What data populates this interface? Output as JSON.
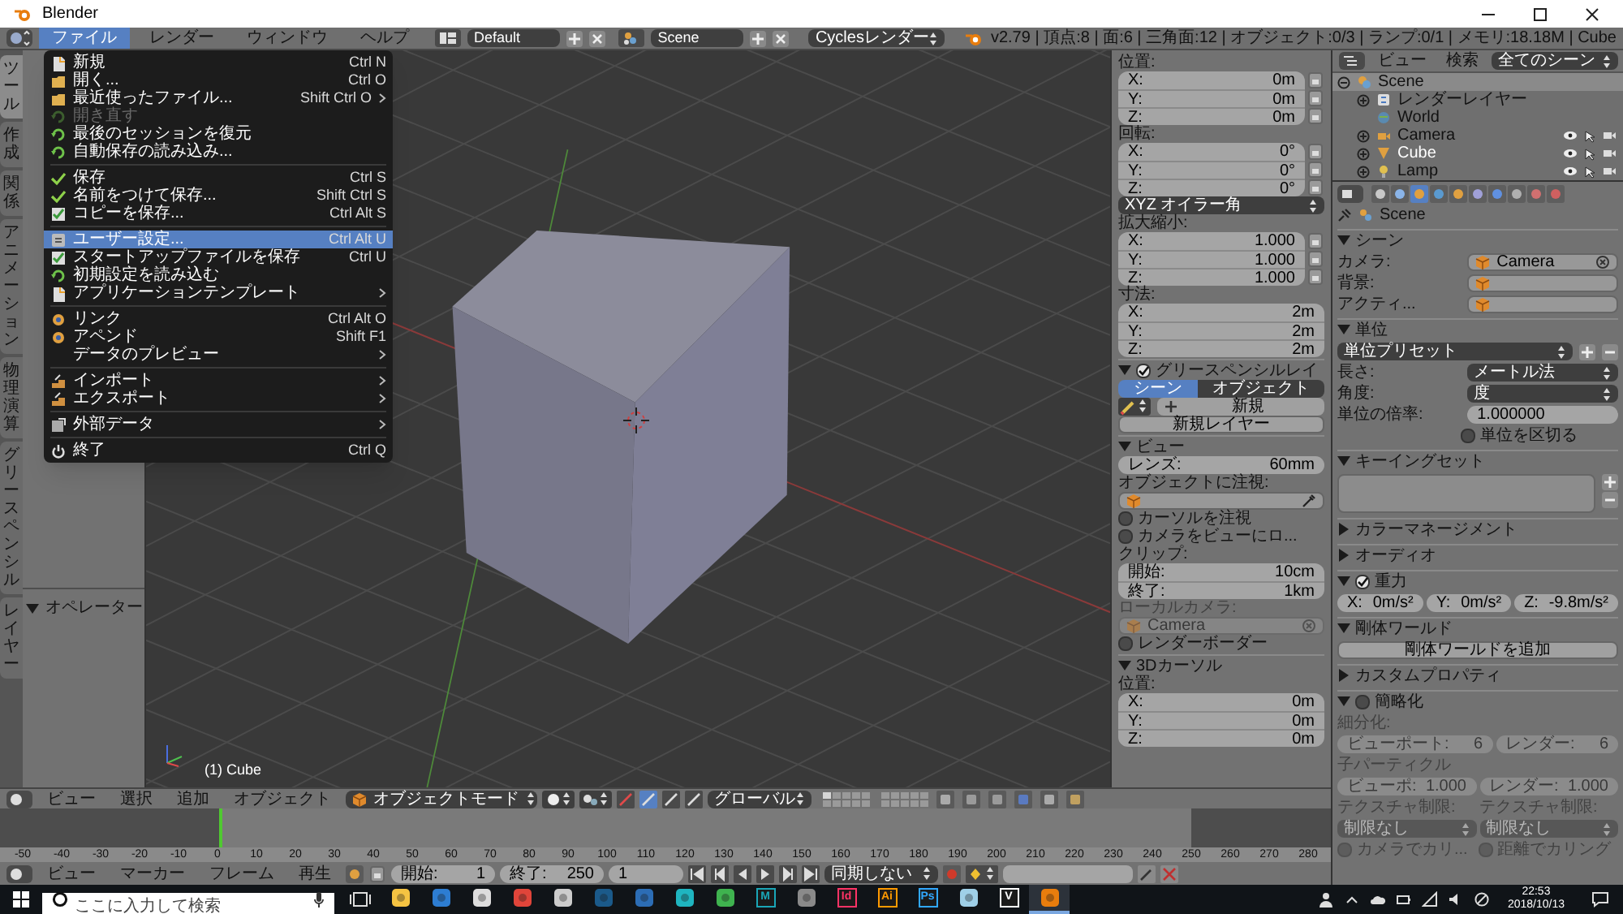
{
  "window": {
    "title": "Blender"
  },
  "info_header": {
    "menus": [
      {
        "label": "ファイル",
        "selected": true
      },
      {
        "label": "レンダー",
        "selected": false
      },
      {
        "label": "ウィンドウ",
        "selected": false
      },
      {
        "label": "ヘルプ",
        "selected": false
      }
    ],
    "layout": "Default",
    "scene": "Scene",
    "engine": "Cyclesレンダー",
    "stats": "v2.79 | 頂点:8 | 面:6 | 三角面:12 | オブジェクト:0/3 | ランプ:0/1 | メモリ:18.18M | Cube"
  },
  "file_menu": [
    {
      "kind": "file",
      "label": "新規",
      "shortcut": "Ctrl N",
      "submenu": false,
      "disabled": false,
      "selected": false
    },
    {
      "kind": "folder",
      "label": "開く...",
      "shortcut": "Ctrl O",
      "submenu": false,
      "disabled": false,
      "selected": false
    },
    {
      "kind": "folder",
      "label": "最近使ったファイル...",
      "shortcut": "Shift Ctrl O",
      "submenu": true,
      "disabled": false,
      "selected": false
    },
    {
      "kind": "recover",
      "label": "開き直す",
      "submenu": false,
      "disabled": true,
      "selected": false
    },
    {
      "kind": "recover",
      "label": "最後のセッションを復元",
      "submenu": false,
      "disabled": false,
      "selected": false
    },
    {
      "kind": "recover",
      "label": "自動保存の読み込み...",
      "submenu": false,
      "disabled": false,
      "selected": false
    },
    {
      "kind": "separator"
    },
    {
      "kind": "check",
      "label": "保存",
      "shortcut": "Ctrl S",
      "submenu": false,
      "disabled": false,
      "selected": false
    },
    {
      "kind": "check",
      "label": "名前をつけて保存...",
      "shortcut": "Shift Ctrl S",
      "submenu": false,
      "disabled": false,
      "selected": false
    },
    {
      "kind": "checkbox",
      "label": "コピーを保存...",
      "shortcut": "Ctrl Alt S",
      "submenu": false,
      "disabled": false,
      "selected": false
    },
    {
      "kind": "separator"
    },
    {
      "kind": "prefs",
      "label": "ユーザー設定...",
      "shortcut": "Ctrl Alt U",
      "submenu": false,
      "disabled": false,
      "selected": true
    },
    {
      "kind": "checkbox",
      "label": "スタートアップファイルを保存",
      "shortcut": "Ctrl U",
      "submenu": false,
      "disabled": false,
      "selected": false
    },
    {
      "kind": "recover",
      "label": "初期設定を読み込む",
      "submenu": false,
      "disabled": false,
      "selected": false
    },
    {
      "kind": "file",
      "label": "アプリケーションテンプレート",
      "submenu": true,
      "disabled": false,
      "selected": false
    },
    {
      "kind": "separator"
    },
    {
      "kind": "link",
      "label": "リンク",
      "shortcut": "Ctrl Alt O",
      "submenu": false,
      "disabled": false,
      "selected": false
    },
    {
      "kind": "link",
      "label": "アペンド",
      "shortcut": "Shift F1",
      "submenu": false,
      "disabled": false,
      "selected": false
    },
    {
      "kind": "none",
      "label": "データのプレビュー",
      "submenu": true,
      "disabled": false,
      "selected": false
    },
    {
      "kind": "separator"
    },
    {
      "kind": "io",
      "label": "インポート",
      "submenu": true,
      "disabled": false,
      "selected": false
    },
    {
      "kind": "io",
      "label": "エクスポート",
      "submenu": true,
      "disabled": false,
      "selected": false
    },
    {
      "kind": "separator"
    },
    {
      "kind": "external",
      "label": "外部データ",
      "submenu": true,
      "disabled": false,
      "selected": false
    },
    {
      "kind": "separator"
    },
    {
      "kind": "power",
      "label": "終了",
      "shortcut": "Ctrl Q",
      "submenu": false,
      "disabled": false,
      "selected": false
    }
  ],
  "toolshelf": {
    "tabs": [
      {
        "label": "ツール",
        "selected": true
      },
      {
        "label": "作成",
        "selected": false
      },
      {
        "label": "関係",
        "selected": false
      },
      {
        "label": "アニメーション",
        "selected": false
      },
      {
        "label": "物理演算",
        "selected": false
      },
      {
        "label": "グリースペンシル",
        "selected": false
      },
      {
        "label": "レイヤー",
        "selected": false
      }
    ],
    "operator": {
      "title": "オペレーター",
      "expanded": true
    }
  },
  "viewport": {
    "label": "(1) Cube"
  },
  "npanel": {
    "rows": [
      {
        "kind": "label",
        "text": "位置:"
      },
      {
        "kind": "vector",
        "locks": true,
        "fields": [
          {
            "label": "X:",
            "value": "0m"
          },
          {
            "label": "Y:",
            "value": "0m"
          },
          {
            "label": "Z:",
            "value": "0m"
          }
        ]
      },
      {
        "kind": "label",
        "text": "回転:"
      },
      {
        "kind": "vector",
        "locks": true,
        "fields": [
          {
            "label": "X:",
            "value": "0°"
          },
          {
            "label": "Y:",
            "value": "0°"
          },
          {
            "label": "Z:",
            "value": "0°"
          }
        ]
      },
      {
        "kind": "dropdown",
        "value": "XYZ オイラー角"
      },
      {
        "kind": "label",
        "text": "拡大縮小:"
      },
      {
        "kind": "vector",
        "locks": true,
        "fields": [
          {
            "label": "X:",
            "value": "1.000"
          },
          {
            "label": "Y:",
            "value": "1.000"
          },
          {
            "label": "Z:",
            "value": "1.000"
          }
        ]
      },
      {
        "kind": "label",
        "text": "寸法:"
      },
      {
        "kind": "vector",
        "locks": false,
        "fields": [
          {
            "label": "X:",
            "value": "2m"
          },
          {
            "label": "Y:",
            "value": "2m"
          },
          {
            "label": "Z:",
            "value": "2m"
          }
        ]
      },
      {
        "kind": "panel",
        "title": "グリースペンシルレイ",
        "expanded": true,
        "checked": true
      },
      {
        "kind": "tabs",
        "items": [
          {
            "label": "シーン",
            "selected": true
          },
          {
            "label": "オブジェクト",
            "selected": false
          }
        ]
      },
      {
        "kind": "new-row",
        "text": "新規"
      },
      {
        "kind": "button",
        "text": "新規レイヤー"
      },
      {
        "kind": "panel",
        "title": "ビュー",
        "expanded": true
      },
      {
        "kind": "number",
        "label": "レンズ:",
        "value": "60mm"
      },
      {
        "kind": "label",
        "text": "オブジェクトに注視:"
      },
      {
        "kind": "field",
        "eyedropper": true
      },
      {
        "kind": "checkbox",
        "label": "カーソルを注視",
        "checked": false
      },
      {
        "kind": "checkbox",
        "label": "カメラをビューにロ...",
        "checked": false
      },
      {
        "kind": "label",
        "text": "クリップ:"
      },
      {
        "kind": "vector",
        "locks": false,
        "fields": [
          {
            "label": "開始:",
            "value": "10cm"
          },
          {
            "label": "終了:",
            "value": "1km"
          }
        ]
      },
      {
        "kind": "label",
        "text": "ローカルカメラ:",
        "disabled": true
      },
      {
        "kind": "field",
        "value": "Camera",
        "clear": true,
        "disabled": true
      },
      {
        "kind": "checkbox",
        "label": "レンダーボーダー",
        "checked": false
      },
      {
        "kind": "panel",
        "title": "3Dカーソル",
        "expanded": true
      },
      {
        "kind": "label",
        "text": "位置:"
      },
      {
        "kind": "vector",
        "locks": false,
        "fields": [
          {
            "label": "X:",
            "value": "0m"
          },
          {
            "label": "Y:",
            "value": "0m"
          },
          {
            "label": "Z:",
            "value": "0m"
          }
        ]
      }
    ]
  },
  "outliner": {
    "menus": [
      "ビュー",
      "検索"
    ],
    "filter": "全てのシーン",
    "tree": [
      {
        "kind": "scene",
        "label": "Scene",
        "expanded": true,
        "selected": true,
        "active": false,
        "children": [
          {
            "kind": "renderlayer",
            "label": "レンダーレイヤー",
            "expanded": false,
            "selected": false,
            "active": false
          },
          {
            "kind": "world",
            "label": "World",
            "selected": false,
            "active": false
          },
          {
            "kind": "camera",
            "label": "Camera",
            "expanded": false,
            "selected": false,
            "active": false
          },
          {
            "kind": "mesh",
            "label": "Cube",
            "expanded": false,
            "selected": false,
            "active": true
          },
          {
            "kind": "lamp",
            "label": "Lamp",
            "expanded": false,
            "selected": false,
            "active": false
          }
        ]
      }
    ]
  },
  "properties": {
    "tabs": [
      {
        "selected": false
      },
      {
        "selected": false
      },
      {
        "selected": true
      },
      {
        "selected": false
      },
      {
        "selected": false
      },
      {
        "selected": false
      },
      {
        "selected": false
      },
      {
        "selected": false
      },
      {
        "selected": false
      },
      {
        "selected": false
      }
    ],
    "rows": [
      {
        "kind": "breadcrumb",
        "text": "Scene"
      },
      {
        "kind": "panel",
        "title": "シーン",
        "expanded": true
      },
      {
        "kind": "field",
        "label": "カメラ:",
        "value": "Camera",
        "clear": true
      },
      {
        "kind": "field",
        "label": "背景:"
      },
      {
        "kind": "field",
        "label": "アクティ..."
      },
      {
        "kind": "panel",
        "title": "単位",
        "expanded": true
      },
      {
        "kind": "dropdown",
        "value": "単位プリセット",
        "add_remove": true
      },
      {
        "kind": "dropdown",
        "label": "長さ:",
        "value": "メートル法"
      },
      {
        "kind": "dropdown",
        "label": "角度:",
        "value": "度"
      },
      {
        "kind": "number",
        "caption": "単位の倍率:",
        "value": "1.000000"
      },
      {
        "kind": "checkbox",
        "label": "単位を区切る",
        "checked": false,
        "indent": true
      },
      {
        "kind": "panel",
        "title": "キーイングセット",
        "expanded": true
      },
      {
        "kind": "listbox"
      },
      {
        "kind": "panel",
        "title": "カラーマネージメント",
        "expanded": false
      },
      {
        "kind": "panel",
        "title": "オーディオ",
        "expanded": false
      },
      {
        "kind": "panel",
        "title": "重力",
        "expanded": true,
        "checked": true
      },
      {
        "kind": "hrow",
        "items": [
          {
            "kind": "number",
            "label": "X:",
            "value": "0m/s²"
          },
          {
            "kind": "number",
            "label": "Y:",
            "value": "0m/s²"
          },
          {
            "kind": "number",
            "label": "Z:",
            "value": "-9.8m/s²"
          }
        ]
      },
      {
        "kind": "panel",
        "title": "剛体ワールド",
        "expanded": true
      },
      {
        "kind": "button",
        "text": "剛体ワールドを追加"
      },
      {
        "kind": "panel",
        "title": "カスタムプロパティ",
        "expanded": false
      },
      {
        "kind": "panel",
        "title": "簡略化",
        "expanded": true,
        "checked": false
      },
      {
        "kind": "label",
        "text": "細分化:",
        "disabled": true
      },
      {
        "kind": "hrow",
        "disabled": true,
        "items": [
          {
            "kind": "number",
            "label": "ビューポート:",
            "value": "6"
          },
          {
            "kind": "number",
            "label": "レンダー:",
            "value": "6"
          }
        ]
      },
      {
        "kind": "label",
        "text": "子パーティクル",
        "disabled": true
      },
      {
        "kind": "hrow",
        "disabled": true,
        "items": [
          {
            "kind": "number",
            "label": "ビューポ:",
            "value": "1.000"
          },
          {
            "kind": "number",
            "label": "レンダー:",
            "value": "1.000"
          }
        ]
      },
      {
        "kind": "hrow",
        "disabled": true,
        "items": [
          {
            "kind": "label",
            "text": "テクスチャ制限:"
          },
          {
            "kind": "label",
            "text": "テクスチャ制限:"
          }
        ]
      },
      {
        "kind": "hrow",
        "disabled": true,
        "items": [
          {
            "kind": "dropdown",
            "value": "制限なし"
          },
          {
            "kind": "dropdown",
            "value": "制限なし"
          }
        ]
      },
      {
        "kind": "hrow",
        "disabled": true,
        "items": [
          {
            "kind": "checkbox",
            "label": "カメラでカリ...",
            "checked": false
          },
          {
            "kind": "checkbox",
            "label": "距離でカリング",
            "checked": false
          }
        ]
      }
    ]
  },
  "view3d_header": {
    "menus": [
      "ビュー",
      "選択",
      "追加",
      "オブジェクト"
    ],
    "mode": "オブジェクトモード",
    "orientation": "グローバル",
    "manipulators": [
      {
        "selected": false
      },
      {
        "selected": true
      },
      {
        "selected": false
      },
      {
        "selected": false
      }
    ],
    "layers": [
      {
        "selected": true
      },
      {
        "selected": false
      },
      {
        "selected": false
      },
      {
        "selected": false
      },
      {
        "selected": false
      },
      {
        "selected": false
      },
      {
        "selected": false
      },
      {
        "selected": false
      },
      {
        "selected": false
      },
      {
        "selected": false
      },
      {
        "selected": false
      },
      {
        "selected": false
      },
      {
        "selected": false
      },
      {
        "selected": false
      },
      {
        "selected": false
      },
      {
        "selected": false
      },
      {
        "selected": false
      },
      {
        "selected": false
      },
      {
        "selected": false
      },
      {
        "selected": false
      }
    ]
  },
  "timeline": {
    "ruler": [
      "-50",
      "-40",
      "-30",
      "-20",
      "-10",
      "0",
      "10",
      "20",
      "30",
      "40",
      "50",
      "60",
      "70",
      "80",
      "90",
      "100",
      "110",
      "120",
      "130",
      "140",
      "150",
      "160",
      "170",
      "180",
      "190",
      "200",
      "210",
      "220",
      "230",
      "240",
      "250",
      "260",
      "270",
      "280"
    ],
    "menus": [
      "ビュー",
      "マーカー",
      "フレーム",
      "再生"
    ],
    "start": {
      "label": "開始:",
      "value": "1"
    },
    "end": {
      "label": "終了:",
      "value": "250"
    },
    "current": "1",
    "sync": "同期しない"
  },
  "taskbar": {
    "search_placeholder": "ここに入力して検索",
    "apps": [
      {
        "color": "#f5c342",
        "selected": false
      },
      {
        "color": "#2d7dd2",
        "selected": false
      },
      {
        "color": "#dddddd",
        "selected": false
      },
      {
        "color": "#e0453a",
        "selected": false
      },
      {
        "color": "#cccccc",
        "selected": false
      },
      {
        "color": "#1b5a8a",
        "selected": false
      },
      {
        "color": "#2c6db5",
        "selected": false
      },
      {
        "color": "#1fb5c0",
        "selected": false
      },
      {
        "color": "#3fb34f",
        "selected": false
      },
      {
        "color": "#1aa6b7",
        "glyph": "M",
        "selected": false
      },
      {
        "color": "#8a8a8a",
        "selected": false
      },
      {
        "color": "#ff3366",
        "glyph": "Id",
        "selected": false
      },
      {
        "color": "#ff9a00",
        "glyph": "Ai",
        "selected": false
      },
      {
        "color": "#31a8ff",
        "glyph": "Ps",
        "selected": false
      },
      {
        "color": "#9fd0e8",
        "selected": false
      },
      {
        "color": "#ffffff",
        "glyph": "V",
        "selected": false
      },
      {
        "color": "#e87d0d",
        "selected": true
      }
    ],
    "time": "22:53",
    "date": "2018/10/13"
  }
}
